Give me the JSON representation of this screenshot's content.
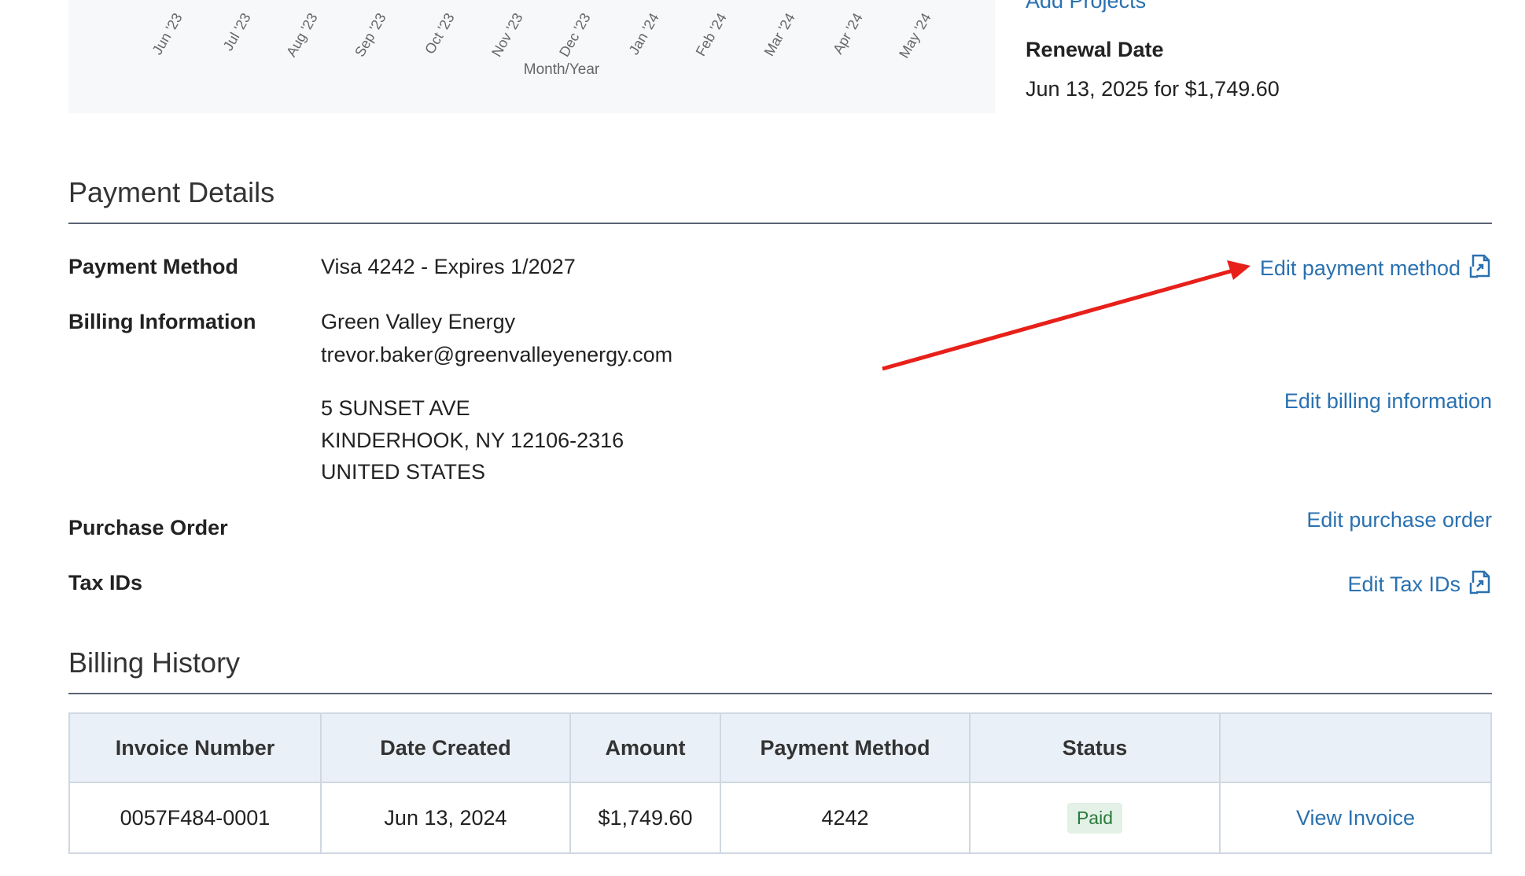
{
  "chart": {
    "x_ticks": [
      "Jun '23",
      "Jul '23",
      "Aug '23",
      "Sep '23",
      "Oct '23",
      "Nov '23",
      "Dec '23",
      "Jan '24",
      "Feb '24",
      "Mar '24",
      "Apr '24",
      "May '24"
    ],
    "xlabel": "Month/Year"
  },
  "right_panel": {
    "top_link": "Add Projects",
    "renewal_label": "Renewal Date",
    "renewal_value": "Jun 13, 2025 for $1,749.60"
  },
  "payment_details": {
    "title": "Payment Details",
    "payment_method_label": "Payment Method",
    "payment_method_value": "Visa 4242 - Expires 1/2027",
    "edit_payment_link": "Edit payment method",
    "billing_label": "Billing Information",
    "billing_company": "Green Valley Energy",
    "billing_email": "trevor.baker@greenvalleyenergy.com",
    "address_line1": "5 SUNSET AVE",
    "address_line2": "KINDERHOOK, NY 12106-2316",
    "address_line3": "UNITED STATES",
    "edit_billing_link": "Edit billing information",
    "purchase_order_label": "Purchase Order",
    "edit_purchase_order_link": "Edit purchase order",
    "tax_ids_label": "Tax IDs",
    "edit_tax_ids_link": "Edit Tax IDs",
    "annotation_arrow_color": "#e8201a"
  },
  "billing_history": {
    "title": "Billing History",
    "columns": [
      "Invoice Number",
      "Date Created",
      "Amount",
      "Payment Method",
      "Status",
      ""
    ],
    "rows": [
      {
        "invoice_number": "0057F484-0001",
        "date_created": "Jun 13, 2024",
        "amount": "$1,749.60",
        "payment_method": "4242",
        "status": "Paid",
        "action": "View Invoice"
      }
    ]
  },
  "colors": {
    "link": "#2a71b0",
    "paid_badge_bg": "#e3f1e6",
    "paid_badge_text": "#2a7a3b",
    "table_header_bg": "#eaf0f7"
  }
}
